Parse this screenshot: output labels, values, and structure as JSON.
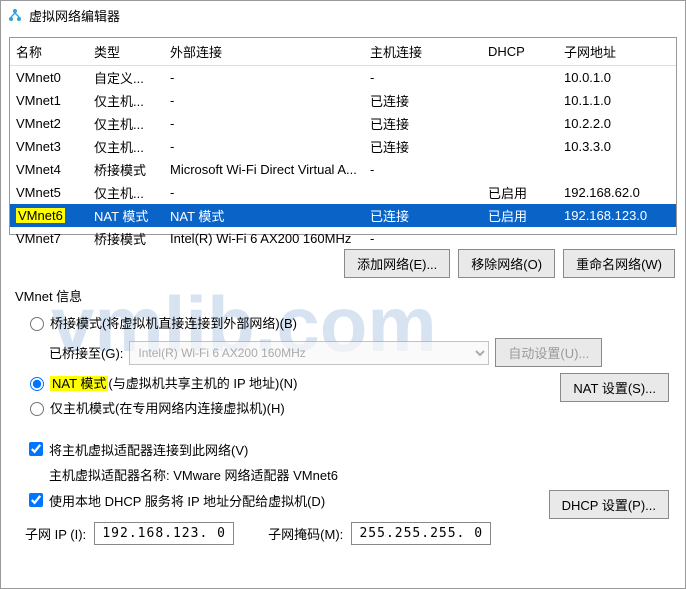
{
  "title": "虚拟网络编辑器",
  "columns": [
    "名称",
    "类型",
    "外部连接",
    "主机连接",
    "DHCP",
    "子网地址"
  ],
  "rows": [
    {
      "name": "VMnet0",
      "type": "自定义...",
      "ext": "-",
      "host": "-",
      "dhcp": "",
      "subnet": "10.0.1.0",
      "sel": false,
      "hl": false
    },
    {
      "name": "VMnet1",
      "type": "仅主机...",
      "ext": "-",
      "host": "已连接",
      "dhcp": "",
      "subnet": "10.1.1.0",
      "sel": false,
      "hl": false
    },
    {
      "name": "VMnet2",
      "type": "仅主机...",
      "ext": "-",
      "host": "已连接",
      "dhcp": "",
      "subnet": "10.2.2.0",
      "sel": false,
      "hl": false
    },
    {
      "name": "VMnet3",
      "type": "仅主机...",
      "ext": "-",
      "host": "已连接",
      "dhcp": "",
      "subnet": "10.3.3.0",
      "sel": false,
      "hl": false
    },
    {
      "name": "VMnet4",
      "type": "桥接模式",
      "ext": "Microsoft Wi-Fi Direct Virtual A...",
      "host": "-",
      "dhcp": "",
      "subnet": "",
      "sel": false,
      "hl": false
    },
    {
      "name": "VMnet5",
      "type": "仅主机...",
      "ext": "-",
      "host": "",
      "dhcp": "已启用",
      "subnet": "192.168.62.0",
      "sel": false,
      "hl": false
    },
    {
      "name": "VMnet6",
      "type": "NAT 模式",
      "ext": "NAT 模式",
      "host": "已连接",
      "dhcp": "已启用",
      "subnet": "192.168.123.0",
      "sel": true,
      "hl": true
    },
    {
      "name": "VMnet7",
      "type": "桥接模式",
      "ext": "Intel(R) Wi-Fi 6 AX200 160MHz",
      "host": "-",
      "dhcp": "",
      "subnet": "",
      "sel": false,
      "hl": false
    }
  ],
  "buttons": {
    "add": "添加网络(E)...",
    "remove": "移除网络(O)",
    "rename": "重命名网络(W)"
  },
  "section": "VMnet 信息",
  "opt_bridge": "桥接模式(将虚拟机直接连接到外部网络)(B)",
  "bridged_to": "已桥接至(G):",
  "bridged_adapter": "Intel(R) Wi-Fi 6 AX200 160MHz",
  "auto_settings": "自动设置(U)...",
  "opt_nat_hl": "NAT 模式",
  "opt_nat_rest": "(与虚拟机共享主机的 IP 地址)(N)",
  "nat_settings": "NAT 设置(S)...",
  "opt_hostonly": "仅主机模式(在专用网络内连接虚拟机)(H)",
  "opt_connect": "将主机虚拟适配器连接到此网络(V)",
  "host_adapter_lbl": "主机虚拟适配器名称: VMware 网络适配器 VMnet6",
  "opt_dhcp": "使用本地 DHCP 服务将 IP 地址分配给虚拟机(D)",
  "dhcp_settings": "DHCP 设置(P)...",
  "subnet_ip_lbl": "子网 IP (I):",
  "subnet_ip": "192.168.123. 0",
  "subnet_mask_lbl": "子网掩码(M):",
  "subnet_mask": "255.255.255. 0",
  "watermark": "vmlib.com"
}
